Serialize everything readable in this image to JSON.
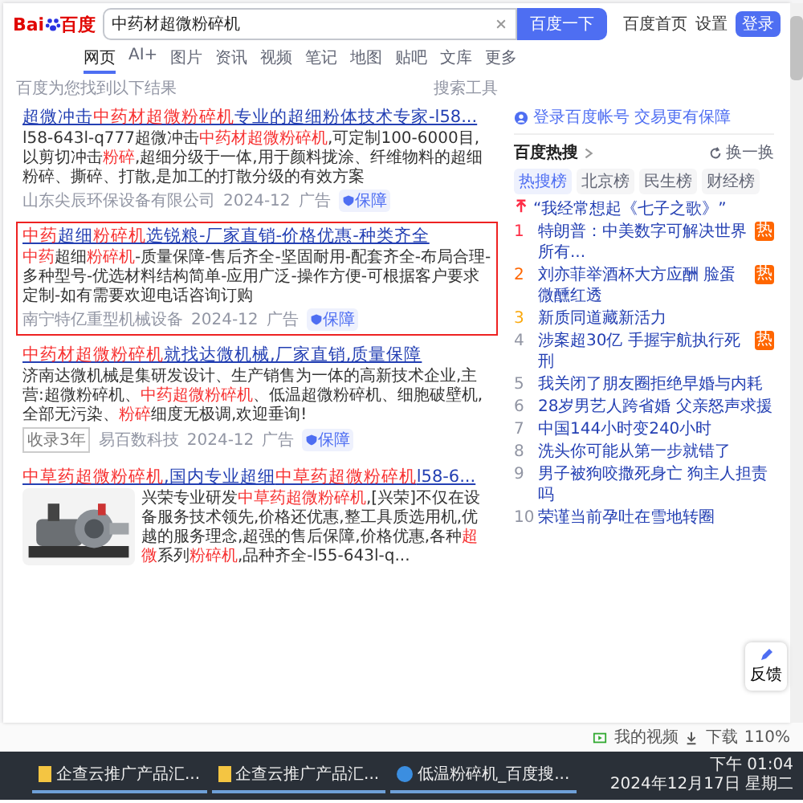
{
  "header": {
    "logo_latin": "Bai",
    "logo_cjk": "百度",
    "query": "中药材超微粉碎机",
    "search_button": "百度一下",
    "links": [
      "百度首页",
      "设置"
    ],
    "login": "登录"
  },
  "tabs": [
    {
      "label": "网页",
      "selected": true
    },
    {
      "label": "AI+",
      "selected": false
    },
    {
      "label": "图片",
      "selected": false
    },
    {
      "label": "资讯",
      "selected": false
    },
    {
      "label": "视频",
      "selected": false
    },
    {
      "label": "笔记",
      "selected": false
    },
    {
      "label": "地图",
      "selected": false
    },
    {
      "label": "贴吧",
      "selected": false
    },
    {
      "label": "文库",
      "selected": false
    },
    {
      "label": "更多",
      "selected": false
    }
  ],
  "result_info": "百度为您找到以下结果",
  "search_tools": "搜索工具",
  "results": [
    {
      "outlined": false,
      "title": [
        {
          "text": "超微冲击",
          "highlight": false
        },
        {
          "text": "中药材超微粉碎机",
          "highlight": true
        },
        {
          "text": "专业的超细粉体技术专家-l58...",
          "highlight": false
        }
      ],
      "description": [
        {
          "text": "l58-643l-q777超微冲击",
          "highlight": false
        },
        {
          "text": "中药材超微粉碎机",
          "highlight": true
        },
        {
          "text": ",可定制100-6000目,以剪切冲击",
          "highlight": false
        },
        {
          "text": "粉碎",
          "highlight": true
        },
        {
          "text": ",超细分级于一体,用于颜料拢涂、纤维物料的超细粉碎、撕碎、打散,是加工的打散分级的有效方案",
          "highlight": false
        }
      ],
      "source": "山东尖辰环保设备有限公司",
      "date": "2024-12",
      "ad": "广告",
      "guarantee": "保障"
    },
    {
      "outlined": true,
      "title": [
        {
          "text": "中药",
          "highlight": true
        },
        {
          "text": "超细",
          "highlight": false
        },
        {
          "text": "粉碎机",
          "highlight": true
        },
        {
          "text": "选锐粮-厂家直销-价格优惠-种类齐全",
          "highlight": false
        }
      ],
      "description": [
        {
          "text": "中药",
          "highlight": true
        },
        {
          "text": "超细",
          "highlight": false
        },
        {
          "text": "粉碎机",
          "highlight": true
        },
        {
          "text": "-质量保障-售后齐全-坚固耐用-配套齐全-布局合理-多种型号-优选材料结构简单-应用广泛-操作方便-可根据客户要求定制-如有需要欢迎电话咨询订购",
          "highlight": false
        }
      ],
      "source": "南宁特亿重型机械设备",
      "date": "2024-12",
      "ad": "广告",
      "guarantee": "保障"
    },
    {
      "outlined": false,
      "title": [
        {
          "text": "中药材超微粉碎机",
          "highlight": true
        },
        {
          "text": "就找达微机械,厂家直销,质量保障",
          "highlight": false
        }
      ],
      "description": [
        {
          "text": "济南达微机械是集研发设计、生产销售为一体的高新技术企业,主营:超微粉碎机、",
          "highlight": false
        },
        {
          "text": "中药超微粉碎机",
          "highlight": true
        },
        {
          "text": "、低温超微粉碎机、细胞破壁机,全部无污染、",
          "highlight": false
        },
        {
          "text": "粉碎",
          "highlight": true
        },
        {
          "text": "细度无极调,欢迎垂询!",
          "highlight": false
        }
      ],
      "tag": "收录3年",
      "source": "易百数科技",
      "date": "2024-12",
      "ad": "广告",
      "guarantee": "保障"
    },
    {
      "outlined": false,
      "kind": "picture",
      "title": [
        {
          "text": "中草药超微粉碎机",
          "highlight": true
        },
        {
          "text": ",国内专业超细",
          "highlight": false
        },
        {
          "text": "中草药超微粉碎机",
          "highlight": true
        },
        {
          "text": "l58-6...",
          "highlight": false
        }
      ],
      "description": [
        {
          "text": "兴荣专业研发",
          "highlight": false
        },
        {
          "text": "中草药超微粉碎机",
          "highlight": true
        },
        {
          "text": ",[兴荣]不仅在设备服务技术领先,价格还优惠,整工具质选用机,优越的服务理念,超强的售后保障,价格优惠,各种",
          "highlight": false
        },
        {
          "text": "超微",
          "highlight": true
        },
        {
          "text": "系列",
          "highlight": false
        },
        {
          "text": "粉碎机",
          "highlight": true
        },
        {
          "text": ",品种齐全-l55-643l-q...",
          "highlight": false
        }
      ]
    }
  ],
  "sidebar": {
    "account_notice": "登录百度帐号 交易更有保障",
    "hot_title": "百度热搜",
    "refresh": "换一换",
    "chips": [
      {
        "label": "热搜榜",
        "selected": true
      },
      {
        "label": "北京榜",
        "selected": false
      },
      {
        "label": "民生榜",
        "selected": false
      },
      {
        "label": "财经榜",
        "selected": false
      }
    ],
    "pinned": "“我经常想起《七子之歌》”",
    "hot_items": [
      {
        "rank": "1",
        "text": "特朗普：中美数字可解决世界所有...",
        "badge": "热"
      },
      {
        "rank": "2",
        "text": "刘亦菲举酒杯大方应酬 脸蛋微醺红透",
        "badge": "热"
      },
      {
        "rank": "3",
        "text": "新质同道藏新活力"
      },
      {
        "rank": "4",
        "text": "涉案超30亿 手握宇航执行死刑",
        "badge": "热"
      },
      {
        "rank": "5",
        "text": "我关闭了朋友圈拒绝早婚与内耗"
      },
      {
        "rank": "6",
        "text": "28岁男艺人跨省婚 父亲怒声求援"
      },
      {
        "rank": "7",
        "text": "中国144小时变240小时"
      },
      {
        "rank": "8",
        "text": "洗头你可能从第一步就错了"
      },
      {
        "rank": "9",
        "text": "男子被狗咬撒死身亡 狗主人担责吗"
      },
      {
        "rank": "10",
        "text": "荣谨当前孕吐在雪地转圈"
      }
    ]
  },
  "feedback": "反馈",
  "status_bar": {
    "video": "我的视频",
    "download": "下载",
    "zoom": "110%"
  },
  "taskbar": {
    "items": [
      "企查云推广产品汇...",
      "企查云推广产品汇...",
      "低温粉碎机_百度搜..."
    ],
    "time": "下午 01:04",
    "date": "2024年12月17日 星期二"
  }
}
